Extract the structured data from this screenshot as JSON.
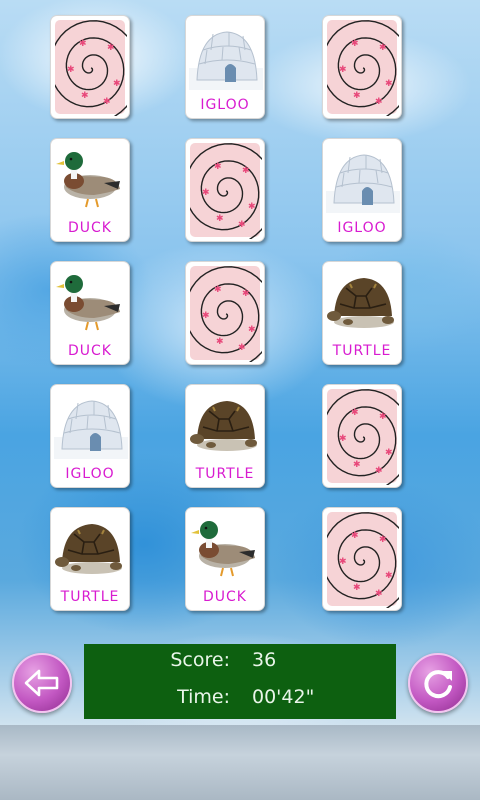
{
  "colors": {
    "card_back": "#f6d3d6",
    "label": "#d81bd0",
    "status_bg": "#0d6010",
    "button": "#c257c2"
  },
  "cards": [
    {
      "state": "face-down",
      "icon": "spiral-pattern-icon"
    },
    {
      "state": "face-up",
      "icon": "igloo-icon",
      "label": "IGLOO"
    },
    {
      "state": "face-down",
      "icon": "spiral-pattern-icon"
    },
    {
      "state": "face-up",
      "icon": "duck-icon",
      "label": "DUCK"
    },
    {
      "state": "face-down",
      "icon": "spiral-pattern-icon"
    },
    {
      "state": "face-up",
      "icon": "igloo-icon",
      "label": "IGLOO"
    },
    {
      "state": "face-up",
      "icon": "duck-icon",
      "label": "DUCK"
    },
    {
      "state": "face-down",
      "icon": "spiral-pattern-icon"
    },
    {
      "state": "face-up",
      "icon": "turtle-icon",
      "label": "TURTLE"
    },
    {
      "state": "face-up",
      "icon": "igloo-icon",
      "label": "IGLOO"
    },
    {
      "state": "face-up",
      "icon": "turtle-icon",
      "label": "TURTLE"
    },
    {
      "state": "face-down",
      "icon": "spiral-pattern-icon"
    },
    {
      "state": "face-up",
      "icon": "turtle-icon",
      "label": "TURTLE"
    },
    {
      "state": "face-up",
      "icon": "duck-icon",
      "label": "DUCK"
    },
    {
      "state": "face-down",
      "icon": "spiral-pattern-icon"
    }
  ],
  "status": {
    "score_label": "Score:",
    "score_value": "36",
    "time_label": "Time:",
    "time_value": "00'42\""
  },
  "buttons": {
    "back_icon": "back-arrow-icon",
    "restart_icon": "restart-icon"
  }
}
